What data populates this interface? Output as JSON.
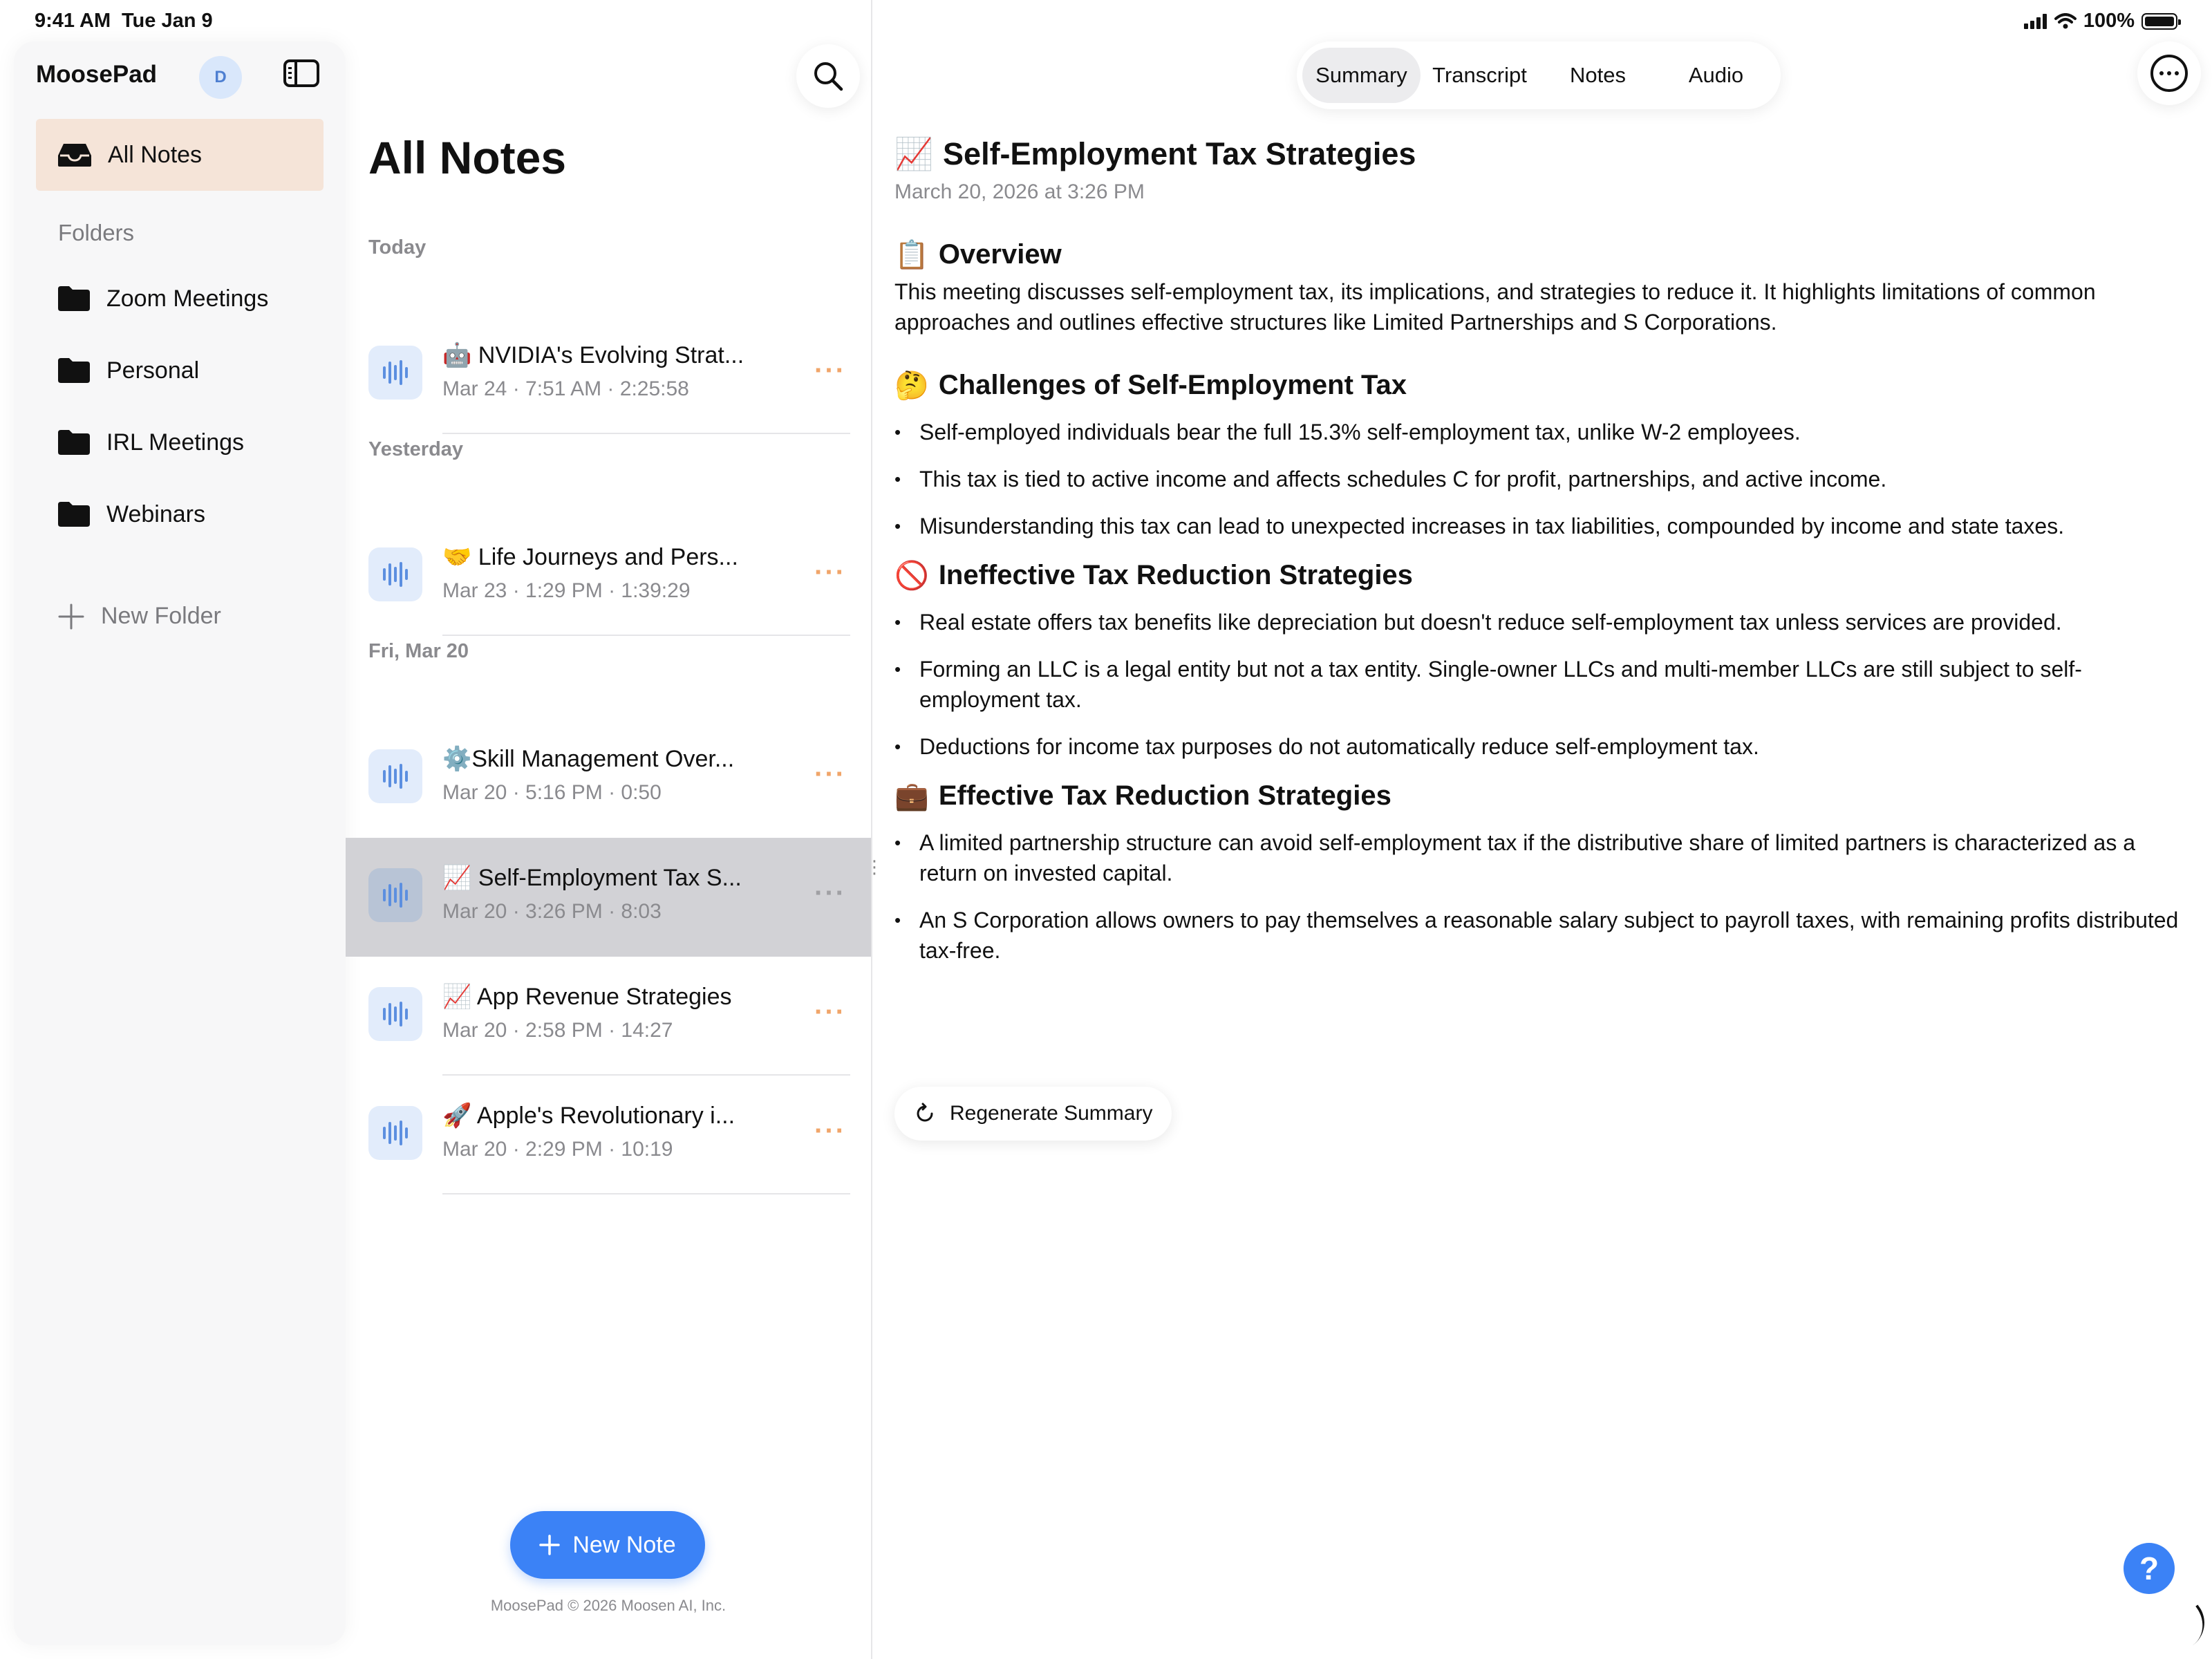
{
  "status_bar": {
    "time": "9:41 AM",
    "date": "Tue Jan 9",
    "battery": "100%"
  },
  "sidebar": {
    "app_name": "MoosePad",
    "avatar_initial": "D",
    "all_notes_label": "All Notes",
    "folders_label": "Folders",
    "folders": [
      {
        "label": "Zoom Meetings",
        "icon": "folder-icon"
      },
      {
        "label": "Personal",
        "icon": "folder-icon"
      },
      {
        "label": "IRL Meetings",
        "icon": "folder-icon"
      },
      {
        "label": "Webinars",
        "icon": "folder-icon"
      }
    ],
    "new_folder_label": "New Folder"
  },
  "list": {
    "title": "All Notes",
    "sections": [
      "Today",
      "Yesterday",
      "Fri, Mar 20"
    ],
    "notes": [
      {
        "emoji": "🤖",
        "title": "NVIDIA's Evolving Strat...",
        "meta": "Mar 24  ·  7:51 AM  ·  2:25:58"
      },
      {
        "emoji": "🤝",
        "title": "Life Journeys and Pers...",
        "meta": "Mar 23  ·  1:29 PM  ·  1:39:29"
      },
      {
        "emoji": "⚙️",
        "title": "Skill Management Over...",
        "meta": "Mar 20  ·  5:16 PM  ·  0:50"
      },
      {
        "emoji": "📈",
        "title": "Self-Employment Tax S...",
        "meta": "Mar 20  ·  3:26 PM  ·  8:03",
        "selected": true
      },
      {
        "emoji": "📈",
        "title": "App Revenue Strategies",
        "meta": "Mar 20  ·  2:58 PM  ·  14:27"
      },
      {
        "emoji": "🚀",
        "title": "Apple's Revolutionary i...",
        "meta": "Mar 20  ·  2:29 PM  ·  10:19"
      }
    ],
    "more_glyph": "···",
    "new_note_label": "New Note",
    "copyright": "MoosePad © 2026 Moosen AI, Inc."
  },
  "detail": {
    "tabs": [
      "Summary",
      "Transcript",
      "Notes",
      "Audio"
    ],
    "active_tab": "Summary",
    "title_emoji": "📈",
    "title": "Self-Employment Tax Strategies",
    "date": "March 20, 2026 at 3:26 PM",
    "sections": [
      {
        "emoji": "📋",
        "heading": "Overview",
        "paragraph": "This meeting discusses self-employment tax, its implications, and strategies to reduce it. It highlights limitations of common approaches and outlines effective structures like Limited Partnerships and S Corporations."
      },
      {
        "emoji": "🤔",
        "heading": "Challenges of Self-Employment Tax",
        "bullets": [
          "Self-employed individuals bear the full 15.3% self-employment tax, unlike W-2 employees.",
          "This tax is tied to active income and affects schedules C for profit, partnerships, and active income.",
          "Misunderstanding this tax can lead to unexpected increases in tax liabilities, compounded by income and state taxes."
        ]
      },
      {
        "emoji": "🚫",
        "heading": "Ineffective Tax Reduction Strategies",
        "bullets": [
          "Real estate offers tax benefits like depreciation but doesn't reduce self-employment tax unless services are provided.",
          "Forming an LLC is a legal entity but not a tax entity. Single-owner LLCs and multi-member LLCs are still subject to self-employment tax.",
          "Deductions for income tax purposes do not automatically reduce self-employment tax."
        ]
      },
      {
        "emoji": "💼",
        "heading": "Effective Tax Reduction Strategies",
        "bullets": [
          "A limited partnership structure can avoid self-employment tax if the distributive share of limited partners is characterized as a return on invested capital.",
          "An S Corporation allows owners to pay themselves a reasonable salary subject to payroll taxes, with remaining profits distributed tax-free."
        ]
      }
    ],
    "regenerate_label": "Regenerate Summary",
    "help_label": "?"
  },
  "colors": {
    "accent": "#3b82f6",
    "selected_nav": "#f5e4d8",
    "selected_row": "#d2d2d6",
    "more_dots": "#f0a56a"
  }
}
